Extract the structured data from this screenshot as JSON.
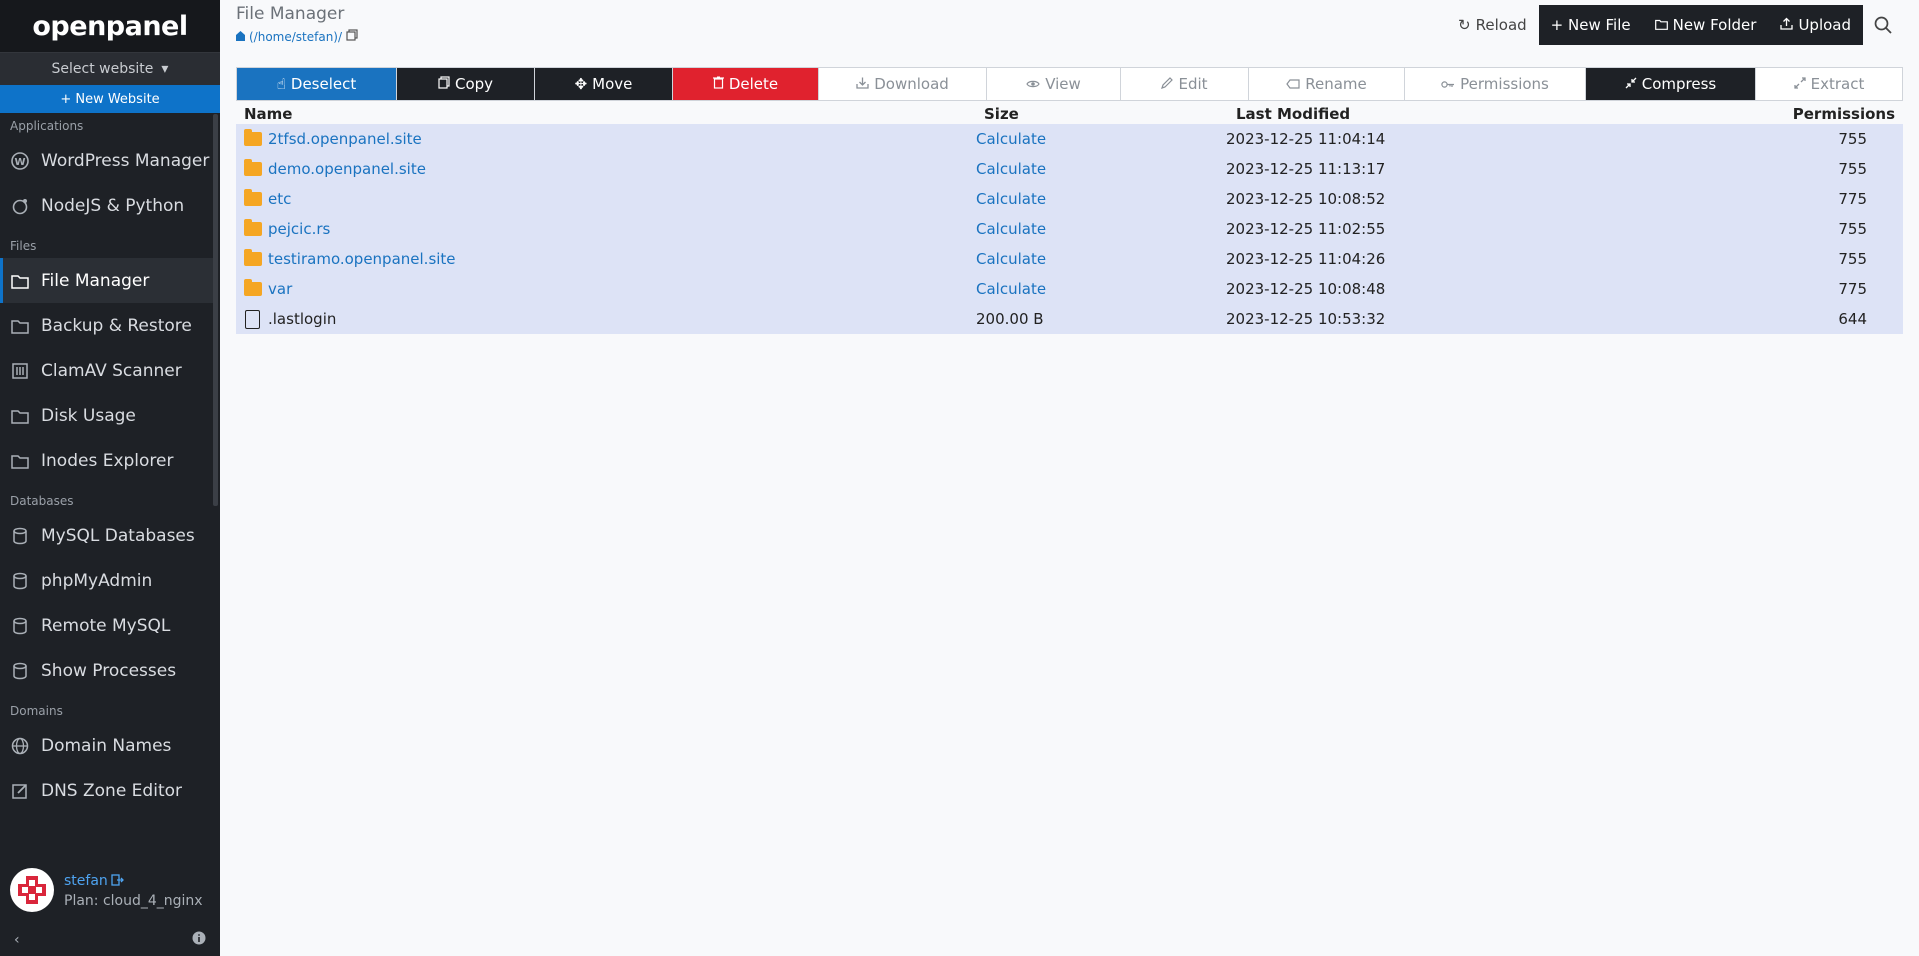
{
  "sidebar": {
    "logo": "openpanel",
    "select_website": "Select website",
    "new_website": "+ New Website",
    "sections": [
      {
        "title": "Applications",
        "items": [
          {
            "label": "WordPress Manager",
            "icon": "wordpress-icon"
          },
          {
            "label": "NodeJS & Python",
            "icon": "node-icon"
          }
        ]
      },
      {
        "title": "Files",
        "items": [
          {
            "label": "File Manager",
            "icon": "folder-icon",
            "active": true
          },
          {
            "label": "Backup & Restore",
            "icon": "backup-icon"
          },
          {
            "label": "ClamAV Scanner",
            "icon": "scanner-icon"
          },
          {
            "label": "Disk Usage",
            "icon": "disk-icon"
          },
          {
            "label": "Inodes Explorer",
            "icon": "inodes-icon"
          }
        ]
      },
      {
        "title": "Databases",
        "items": [
          {
            "label": "MySQL Databases",
            "icon": "database-icon"
          },
          {
            "label": "phpMyAdmin",
            "icon": "database-icon"
          },
          {
            "label": "Remote MySQL",
            "icon": "database-icon"
          },
          {
            "label": "Show Processes",
            "icon": "database-icon"
          }
        ]
      },
      {
        "title": "Domains",
        "items": [
          {
            "label": "Domain Names",
            "icon": "globe-icon"
          },
          {
            "label": "DNS Zone Editor",
            "icon": "edit-icon"
          }
        ]
      }
    ],
    "user": {
      "name": "stefan",
      "plan": "Plan: cloud_4_nginx"
    }
  },
  "header": {
    "title": "File Manager",
    "breadcrumb": "(/home/stefan)/",
    "reload": "Reload",
    "new_file": "+ New File",
    "new_folder": "New Folder",
    "upload": "Upload"
  },
  "toolbar": {
    "deselect": "Deselect",
    "copy": "Copy",
    "move": "Move",
    "delete": "Delete",
    "download": "Download",
    "view": "View",
    "edit": "Edit",
    "rename": "Rename",
    "permissions": "Permissions",
    "compress": "Compress",
    "extract": "Extract"
  },
  "table": {
    "columns": [
      "Name",
      "Size",
      "Last Modified",
      "Permissions"
    ],
    "rows": [
      {
        "name": "2tfsd.openpanel.site",
        "type": "folder",
        "size": "Calculate",
        "modified": "2023-12-25 11:04:14",
        "perm": "755"
      },
      {
        "name": "demo.openpanel.site",
        "type": "folder",
        "size": "Calculate",
        "modified": "2023-12-25 11:13:17",
        "perm": "755"
      },
      {
        "name": "etc",
        "type": "folder",
        "size": "Calculate",
        "modified": "2023-12-25 10:08:52",
        "perm": "775"
      },
      {
        "name": "pejcic.rs",
        "type": "folder",
        "size": "Calculate",
        "modified": "2023-12-25 11:02:55",
        "perm": "755"
      },
      {
        "name": "testiramo.openpanel.site",
        "type": "folder",
        "size": "Calculate",
        "modified": "2023-12-25 11:04:26",
        "perm": "755"
      },
      {
        "name": "var",
        "type": "folder",
        "size": "Calculate",
        "modified": "2023-12-25 10:08:48",
        "perm": "775"
      },
      {
        "name": ".lastlogin",
        "type": "file",
        "size": "200.00 B",
        "modified": "2023-12-25 10:53:32",
        "perm": "644"
      }
    ]
  }
}
